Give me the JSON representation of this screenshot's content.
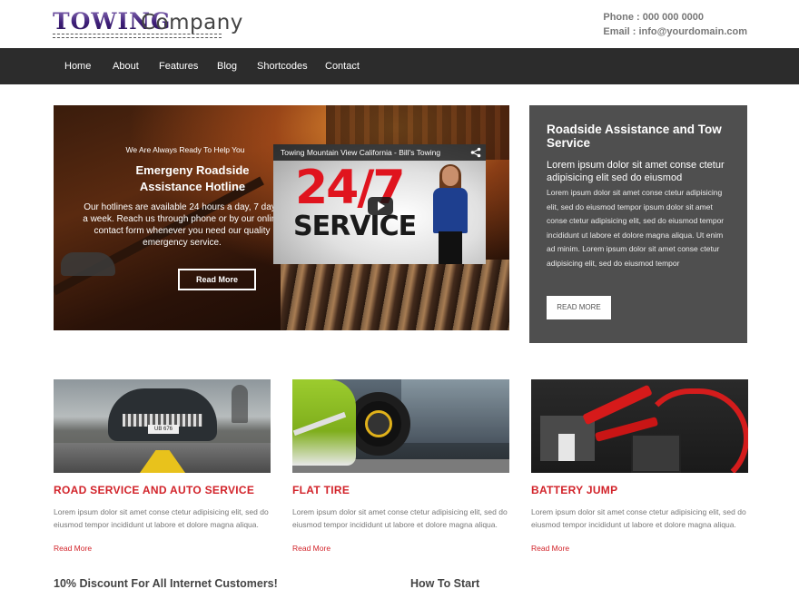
{
  "header": {
    "logo_word1": "TOWING",
    "logo_word2": "Company",
    "phone": "Phone : 000 000 0000",
    "email": "Email : info@yourdomain.com"
  },
  "nav": {
    "items": [
      {
        "label": "Home"
      },
      {
        "label": "About"
      },
      {
        "label": "Features"
      },
      {
        "label": "Blog"
      },
      {
        "label": "Shortcodes"
      },
      {
        "label": "Contact"
      }
    ]
  },
  "hero": {
    "tagline": "We Are Always Ready To Help You",
    "title": "Emergeny Roadside Assistance Hotline",
    "text": "Our hotlines are available 24 hours a day, 7 days a week. Reach us through phone or by our online contact form whenever you need our quality emergency service.",
    "button": "Read More",
    "video": {
      "title": "Towing Mountain View California - Bill's Towing",
      "big_text": "24/7",
      "service_text": "SERVICE",
      "icons": [
        "share-icon",
        "play-icon"
      ]
    }
  },
  "sidebox": {
    "title": "Roadside Assistance and Tow Service",
    "subtitle": "Lorem ipsum dolor sit amet conse ctetur adipisicing elit sed do eiusmod",
    "text": "Lorem ipsum dolor sit amet conse ctetur adipisicing elit, sed do eiusmod tempor ipsum dolor sit amet conse ctetur adipisicing elit, sed do eiusmod tempor incididunt ut labore et dolore magna aliqua. Ut enim ad minim. Lorem ipsum dolor sit amet conse ctetur adipisicing elit, sed do eiusmod tempor",
    "button": "READ MORE"
  },
  "services": [
    {
      "title": "ROAD SERVICE AND AUTO SERVICE",
      "text": "Lorem ipsum dolor sit amet conse ctetur adipisicing elit, sed do eiusmod tempor incididunt ut labore et dolore magna aliqua.",
      "link": "Read More",
      "plate": "UB 676"
    },
    {
      "title": "FLAT TIRE",
      "text": "Lorem ipsum dolor sit amet conse ctetur adipisicing elit, sed do eiusmod tempor incididunt ut labore et dolore magna aliqua.",
      "link": "Read More"
    },
    {
      "title": "BATTERY JUMP",
      "text": "Lorem ipsum dolor sit amet conse ctetur adipisicing elit, sed do eiusmod tempor incididunt ut labore et dolore magna aliqua.",
      "link": "Read More"
    }
  ],
  "bottom": {
    "discount": "10% Discount For All Internet Customers!",
    "how_to": "How To Start"
  },
  "colors": {
    "accent": "#d2232a",
    "nav_bg": "#2c2c2c",
    "sidebox_bg": "#4f4f4f"
  }
}
